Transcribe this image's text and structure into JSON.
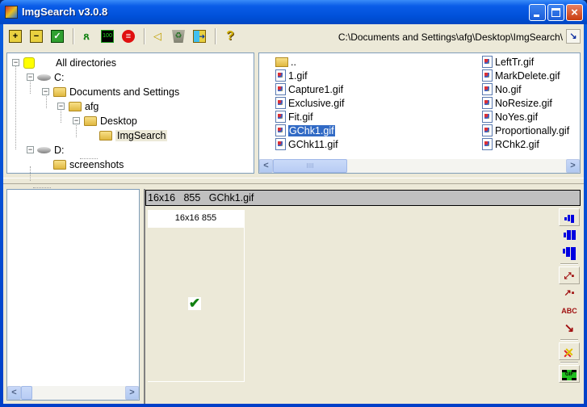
{
  "window": {
    "title": "ImgSearch v3.0.8",
    "controls": {
      "minimize": "minimize",
      "maximize": "maximize",
      "close": "×"
    }
  },
  "toolbar": {
    "buttons": [
      {
        "name": "add-folder",
        "icon": "folder-plus-icon",
        "glyph": "+"
      },
      {
        "name": "remove-folder",
        "icon": "folder-minus-icon",
        "glyph": "−"
      },
      {
        "name": "check-folder",
        "icon": "folder-check-icon",
        "glyph": "✓"
      },
      {
        "name": "run",
        "icon": "running-man-icon",
        "glyph": "🏃"
      },
      {
        "name": "limit",
        "icon": "counter-icon",
        "glyph": "100"
      },
      {
        "name": "stop",
        "icon": "stop-list-icon",
        "glyph": "≡"
      },
      {
        "name": "sound",
        "icon": "speaker-icon",
        "glyph": "🔈"
      },
      {
        "name": "recycle",
        "icon": "recycle-bin-icon",
        "glyph": "♻"
      },
      {
        "name": "export",
        "icon": "export-icon",
        "glyph": "➜"
      },
      {
        "name": "help",
        "icon": "help-icon",
        "glyph": "?"
      }
    ],
    "path": "C:\\Documents and Settings\\afg\\Desktop\\ImgSearch\\",
    "path_button": "↘"
  },
  "tree": {
    "nodes": [
      {
        "label": "All directories",
        "type": "root",
        "expander": "−"
      },
      {
        "label": "C:",
        "type": "drive",
        "expander": "−"
      },
      {
        "label": "Documents and Settings",
        "type": "folder",
        "expander": "−"
      },
      {
        "label": "afg",
        "type": "folder",
        "expander": "−"
      },
      {
        "label": "Desktop",
        "type": "folder",
        "expander": "−"
      },
      {
        "label": "ImgSearch",
        "type": "folder",
        "selected": true
      },
      {
        "label": "D:",
        "type": "drive",
        "expander": "−"
      },
      {
        "label": "screenshots",
        "type": "folder"
      }
    ]
  },
  "files": {
    "column1": [
      "..",
      "1.gif",
      "Capture1.gif",
      "Exclusive.gif",
      "Fit.gif",
      "GChk1.gif",
      "GChk11.gif"
    ],
    "column2": [
      "LeftTr.gif",
      "MarkDelete.gif",
      "No.gif",
      "NoResize.gif",
      "NoYes.gif",
      "Proportionally.gif",
      "RChk2.gif"
    ],
    "selected": "GChk1.gif",
    "scroll_left": "<",
    "scroll_right": ">",
    "scroll_grip": "IIII"
  },
  "preview": {
    "info": "16x16   855   GChk1.gif",
    "thumb_caption": "16x16 855",
    "thumb_glyph": "✔"
  },
  "side_tools": [
    {
      "name": "size-small",
      "icon": "small-bars-icon"
    },
    {
      "name": "size-medium",
      "icon": "medium-bars-icon"
    },
    {
      "name": "size-large",
      "icon": "large-bars-icon"
    },
    {
      "name": "sort-size",
      "icon": "sort-by-size-icon"
    },
    {
      "name": "sort-count",
      "icon": "sort-by-count-icon"
    },
    {
      "name": "sort-name",
      "icon": "sort-by-name-icon",
      "glyph": "ABC"
    },
    {
      "name": "sort-none",
      "icon": "arrow-down-right-icon",
      "glyph": "↘"
    },
    {
      "name": "clear-marks",
      "icon": "clear-marks-icon",
      "glyph": "✕"
    },
    {
      "name": "animate-gif",
      "icon": "gif-film-icon",
      "glyph": "GIF"
    }
  ],
  "left_bottom": {
    "scroll_left": "<",
    "scroll_right": ">"
  }
}
